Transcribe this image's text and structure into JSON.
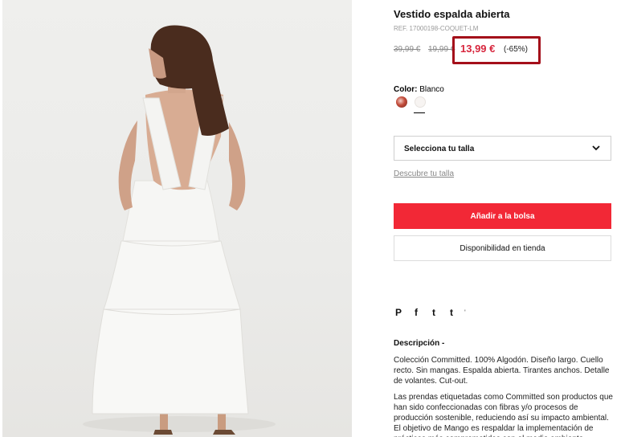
{
  "product": {
    "title": "Vestido espalda abierta",
    "ref": "REF. 17000198-COQUET-LM",
    "original_price": "39,99 €",
    "previous_price": "19,99 €",
    "sale_price": "13,99 €",
    "discount": "(-65%)",
    "color_label": "Color:",
    "color_value": "Blanco"
  },
  "colors": {
    "accent": "#f22836",
    "sale_text": "#d7263d",
    "highlight_box": "#a40f1a"
  },
  "size": {
    "select_label": "Selecciona tu talla",
    "guide_link": "Descubre tu talla"
  },
  "actions": {
    "add_to_bag": "Añadir a la bolsa",
    "store_availability": "Disponibilidad en tienda"
  },
  "share": {
    "icons": [
      "pinterest-icon",
      "facebook-icon",
      "twitter-icon",
      "tumblr-icon"
    ],
    "pinterest": "P",
    "facebook": "f",
    "twitter": "t",
    "tumblr": "t",
    "more": "'"
  },
  "description": {
    "title": "Descripción  -",
    "p1": "Colección Committed. 100% Algodón. Diseño largo. Cuello recto. Sin mangas. Espalda abierta. Tirantes anchos. Detalle de volantes. Cut-out.",
    "p2": "Las prendas etiquetadas como Committed son productos que han sido confeccionadas con fibras y/o procesos de producción sostenible, reduciendo así su impacto ambiental. El objetivo de Mango es respaldar la implementación de prácticas más comprometidas con el medio ambiente"
  }
}
